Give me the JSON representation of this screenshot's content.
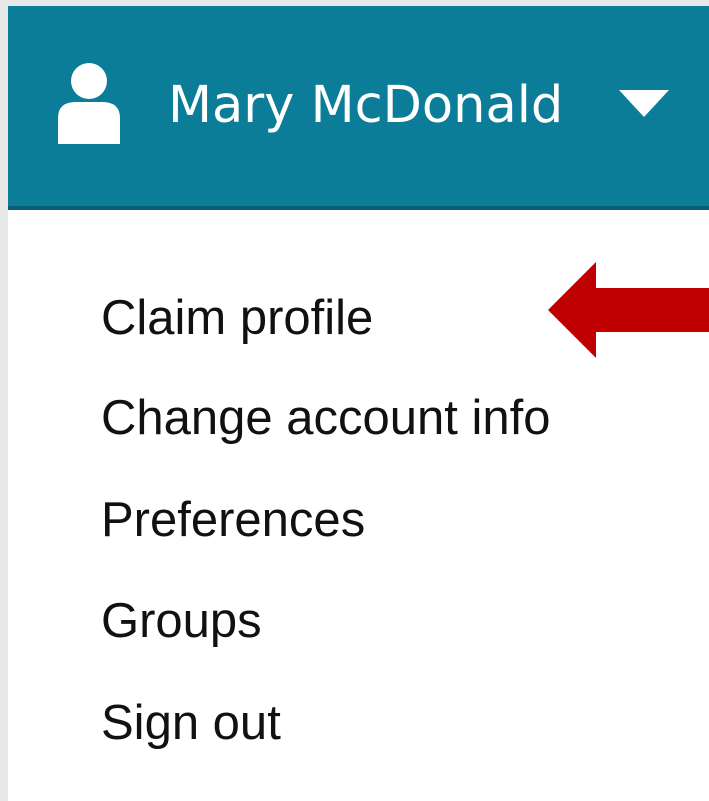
{
  "account": {
    "user_name": "Mary McDonald",
    "user_icon": "user-icon",
    "toggle_icon": "caret-down-icon"
  },
  "menu": {
    "items": [
      {
        "label": "Claim profile"
      },
      {
        "label": "Change account info"
      },
      {
        "label": "Preferences"
      },
      {
        "label": "Groups"
      },
      {
        "label": "Sign out"
      }
    ]
  },
  "annotation": {
    "icon": "left-arrow-icon",
    "color": "#c00000"
  },
  "colors": {
    "header_background": "#0b7d99",
    "header_text": "#ffffff",
    "menu_text": "#111111"
  }
}
